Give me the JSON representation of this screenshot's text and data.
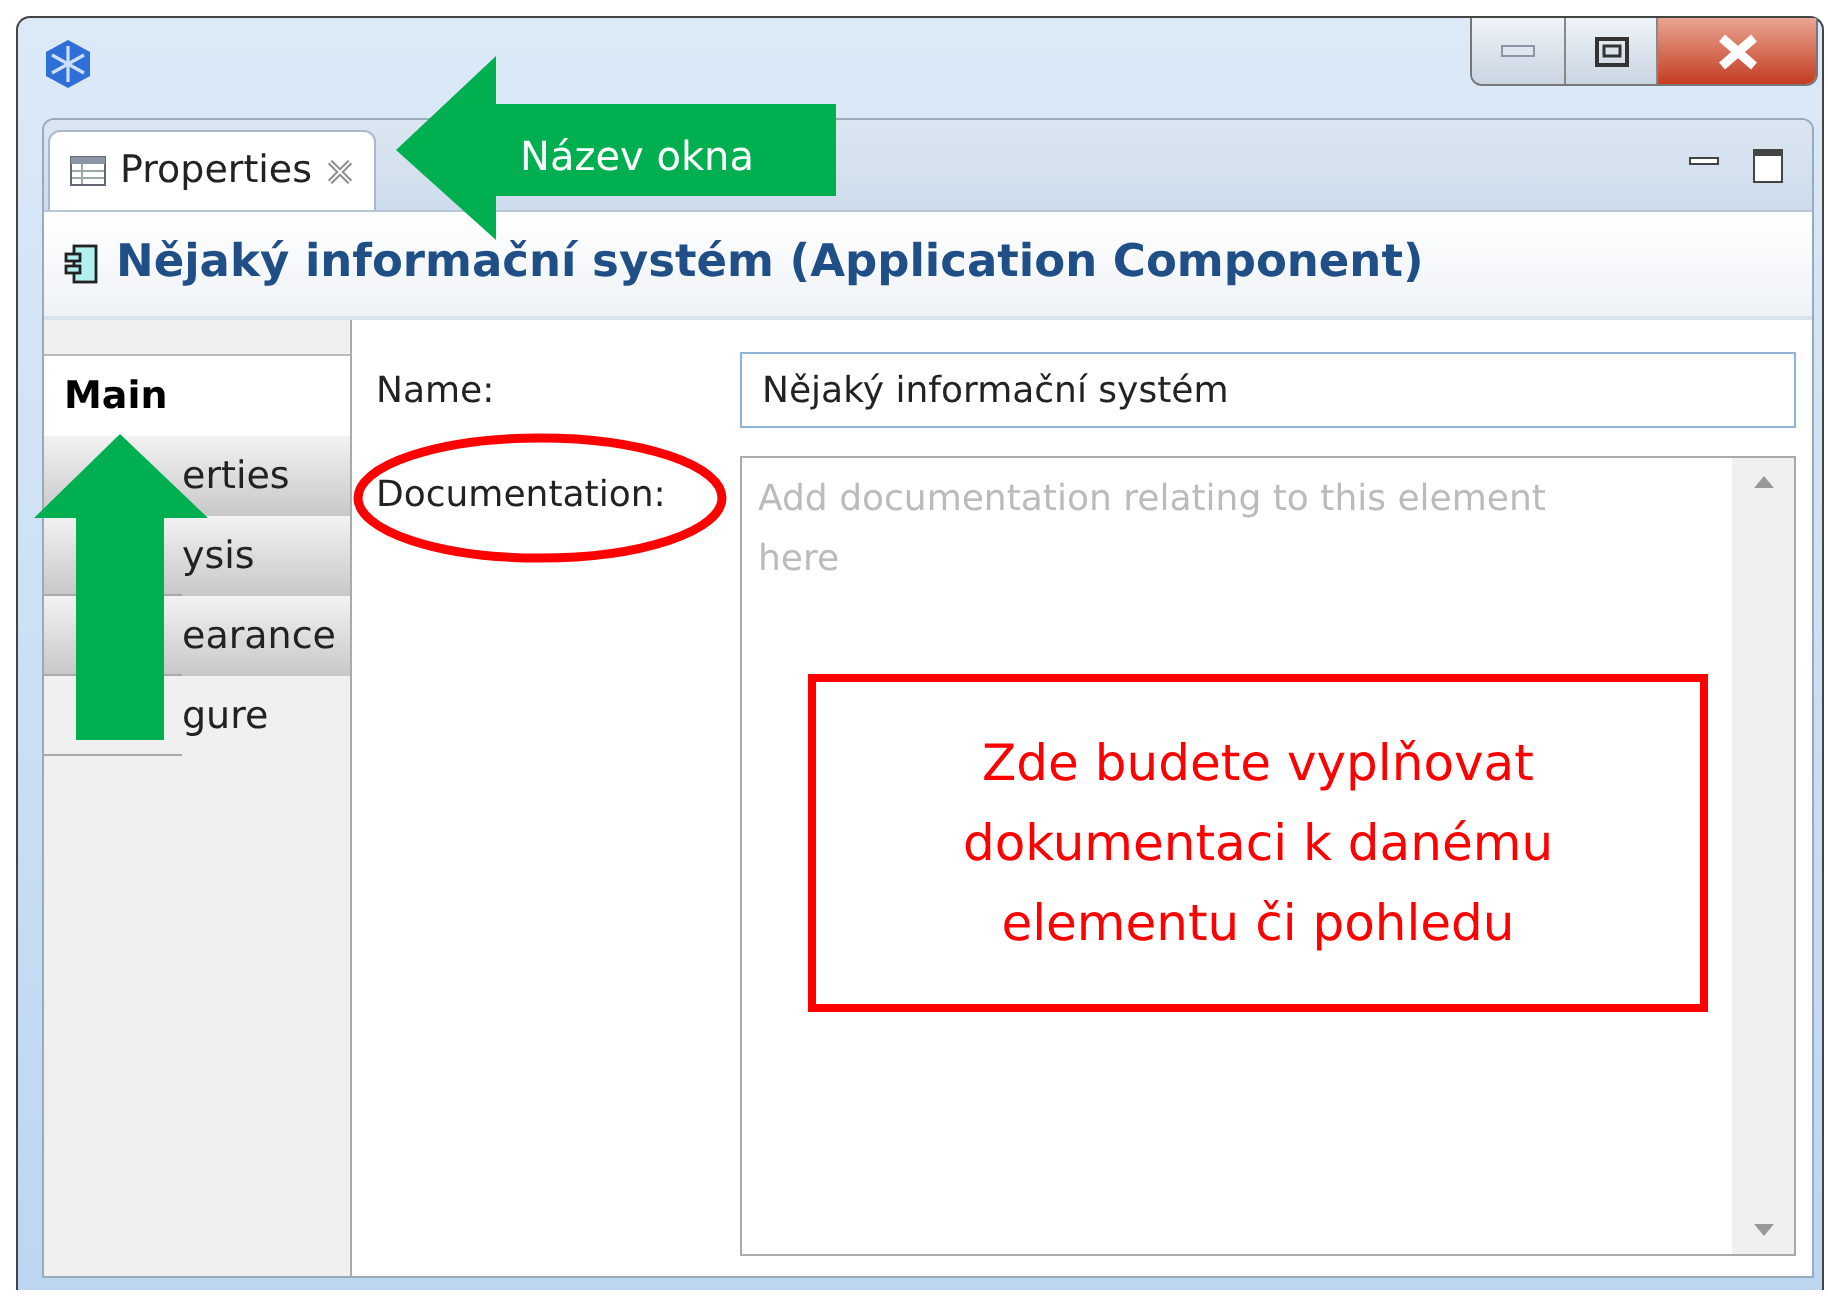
{
  "window": {
    "buttons": [
      {
        "kind": "minimize"
      },
      {
        "kind": "maximize"
      },
      {
        "kind": "close"
      }
    ]
  },
  "view_tab": {
    "label": "Properties",
    "selected": true
  },
  "header": {
    "title": "Nějaký informační systém (Application Component)"
  },
  "sidebar": {
    "tabs": [
      {
        "label": "Main",
        "selected": true
      },
      {
        "label": "erties",
        "selected": false
      },
      {
        "label": "ysis",
        "selected": false
      },
      {
        "label": "earance",
        "selected": false
      },
      {
        "label": "gure",
        "selected": false
      }
    ]
  },
  "form": {
    "name": {
      "label": "Name:",
      "value": "Nějaký informační systém"
    },
    "documentation": {
      "label": "Documentation:",
      "placeholder": "Add documentation relating to this element here"
    }
  },
  "annotations": [
    {
      "kind": "left-arrow",
      "text": "Název okna"
    },
    {
      "kind": "up-arrow"
    },
    {
      "kind": "ellipse"
    },
    {
      "kind": "box",
      "text": "Zde budete vyplňovat dokumentaci k danému elementu či pohledu"
    }
  ]
}
